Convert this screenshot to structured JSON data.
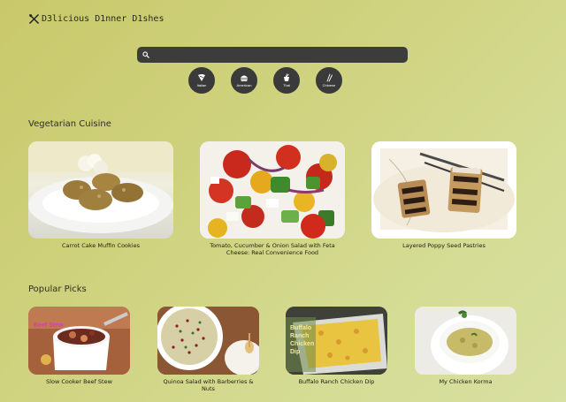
{
  "site": {
    "logo_text": "D3licious D1nner D1shes",
    "search_placeholder": ""
  },
  "categories": [
    {
      "label": "Italian",
      "icon": "pizza-icon"
    },
    {
      "label": "American",
      "icon": "burger-icon"
    },
    {
      "label": "Thai",
      "icon": "noodle-box-icon"
    },
    {
      "label": "Chinese",
      "icon": "chopsticks-icon"
    }
  ],
  "sections": {
    "vegetarian": {
      "title": "Vegetarian Cuisine",
      "items": [
        {
          "caption": "Carrot Cake Muffin Cookies"
        },
        {
          "caption": "Tomato, Cucumber & Onion Salad with Feta Cheese: Real Convenience Food"
        },
        {
          "caption": "Layered Poppy Seed Pastries"
        }
      ]
    },
    "popular": {
      "title": "Popular Picks",
      "items": [
        {
          "caption": "Slow Cooker Beef Stew",
          "overlay": "Beef Stew"
        },
        {
          "caption": "Quinoa Salad with Barberries & Nuts"
        },
        {
          "caption": "Buffalo Ranch Chicken Dip",
          "overlay": "Buffalo Ranch Chicken Dip"
        },
        {
          "caption": "My Chicken Korma"
        }
      ]
    }
  }
}
